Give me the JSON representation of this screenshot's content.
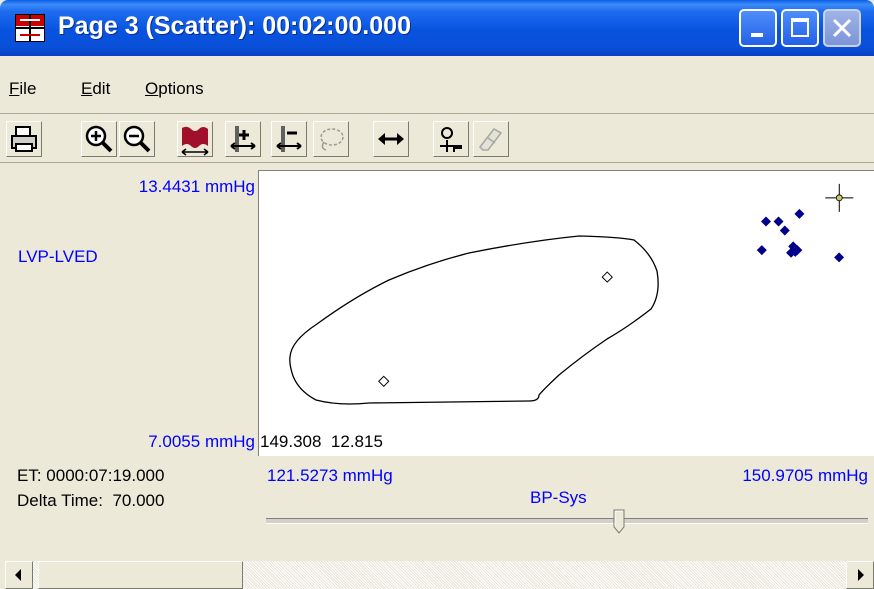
{
  "window": {
    "title": "Page 3 (Scatter): 00:02:00.000"
  },
  "menu": {
    "file": "File",
    "edit": "Edit",
    "options": "Options"
  },
  "toolbar_icons": [
    "printer-icon",
    "zoom-in-icon",
    "zoom-out-icon",
    "autoscale-icon",
    "expand-horizontal-icon",
    "compress-horizontal-icon",
    "lasso-icon",
    "horizontal-arrows-icon",
    "marker-icon",
    "eraser-icon"
  ],
  "y_axis": {
    "max_label": "13.4431 mmHg",
    "min_label": "7.0055 mmHg",
    "channel": "LVP-LVED"
  },
  "x_axis": {
    "min_label": "121.5273 mmHg",
    "max_label": "150.9705 mmHg",
    "channel": "BP-Sys"
  },
  "readout": {
    "x": "149.308",
    "y": "12.815"
  },
  "info": {
    "et": "ET: 0000:07:19.000",
    "delta_label": "Delta Time:",
    "delta_value": "70.000"
  },
  "colors": {
    "axis_text": "#0000ff",
    "points": "#00008b",
    "titlebar": "#0a4fd8"
  },
  "chart_data": {
    "type": "scatter",
    "xlim": [
      121.5273,
      150.9705
    ],
    "ylim": [
      7.0055,
      13.4431
    ],
    "xlabel": "BP-Sys",
    "ylabel": "LVP-LVED",
    "points": [
      {
        "x": 145.8,
        "y": 12.26
      },
      {
        "x": 146.4,
        "y": 12.26
      },
      {
        "x": 146.7,
        "y": 12.05
      },
      {
        "x": 147.4,
        "y": 12.44
      },
      {
        "x": 145.6,
        "y": 11.59
      },
      {
        "x": 147.1,
        "y": 11.68
      },
      {
        "x": 147.3,
        "y": 11.59
      },
      {
        "x": 147.0,
        "y": 11.53
      },
      {
        "x": 147.2,
        "y": 11.55
      },
      {
        "x": 149.3,
        "y": 11.42
      }
    ],
    "selection_markers": [
      {
        "x": 138.2,
        "y": 10.96
      },
      {
        "x": 127.5,
        "y": 8.52
      }
    ],
    "cursor": {
      "x": 149.308,
      "y": 12.815
    }
  }
}
